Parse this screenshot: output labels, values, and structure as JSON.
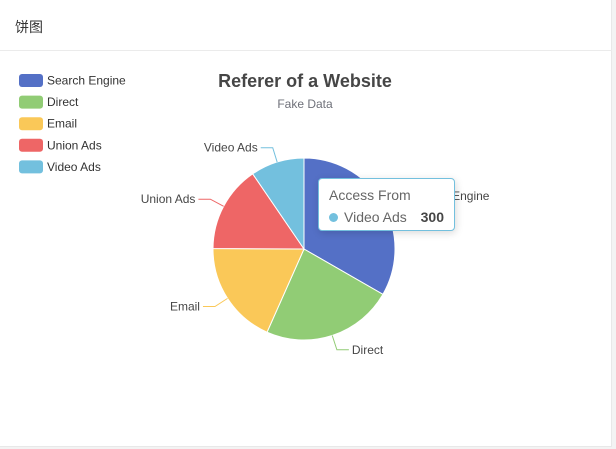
{
  "card": {
    "title": "饼图"
  },
  "tooltip": {
    "title": "Access From",
    "name": "Video Ads",
    "value": "300"
  },
  "colors": [
    "#5470c6",
    "#91cc75",
    "#fac858",
    "#ee6666",
    "#73c0de"
  ],
  "chart_data": {
    "type": "pie",
    "title": "Referer of a Website",
    "subtitle": "Fake Data",
    "legend_position": "top-left",
    "categories": [
      "Search Engine",
      "Direct",
      "Email",
      "Union Ads",
      "Video Ads"
    ],
    "values": [
      1048,
      735,
      580,
      484,
      300
    ],
    "labels_visible": [
      "Search Engine",
      "Direct",
      "Email",
      "Union Ads",
      "Video Ads"
    ]
  }
}
